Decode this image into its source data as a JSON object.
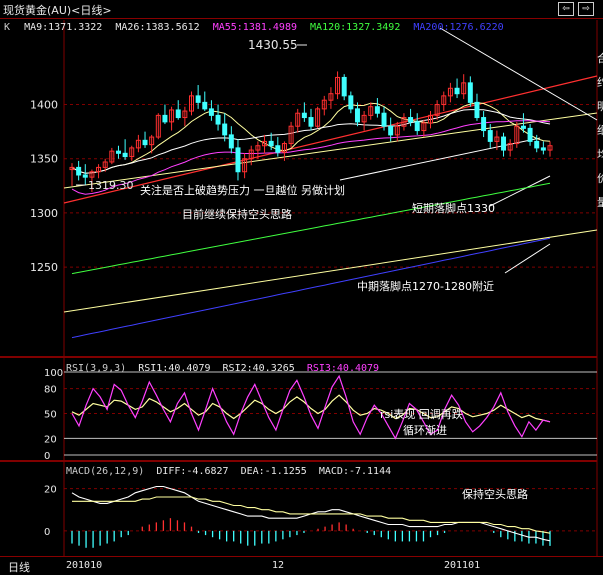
{
  "window": {
    "title": "现货黄金(AU)<日线>",
    "nav_left": "⇦",
    "nav_right": "⇨"
  },
  "main_legend": {
    "prefix": "K",
    "items": [
      {
        "label": "MA9:1371.3322",
        "color": "#e8e8e8"
      },
      {
        "label": "MA26:1383.5612",
        "color": "#e8e8e8"
      },
      {
        "label": "MA55:1381.4989",
        "color": "#ff40ff"
      },
      {
        "label": "MA120:1327.3492",
        "color": "#40ff40"
      },
      {
        "label": "MA200:1276.6220",
        "color": "#4040ff"
      }
    ]
  },
  "rsi_legend": {
    "items": [
      {
        "label": "RSI(3,9,3)",
        "color": "#ccc"
      },
      {
        "label": "RSI1:40.4079",
        "color": "#e8e8e8"
      },
      {
        "label": "RSI2:40.3265",
        "color": "#e8e8e8"
      },
      {
        "label": "RSI3:40.4079",
        "color": "#ff40ff"
      }
    ]
  },
  "macd_legend": {
    "items": [
      {
        "label": "MACD(26,12,9)",
        "color": "#ccc"
      },
      {
        "label": "DIFF:-4.6827",
        "color": "#e8e8e8"
      },
      {
        "label": "DEA:-1.1255",
        "color": "#e8e8e8"
      },
      {
        "label": "MACD:-7.1144",
        "color": "#e8e8e8"
      }
    ]
  },
  "annotations": {
    "high_label": "1430.55",
    "low_label": "1319.30",
    "note_resistance": "关注是否上破趋势压力 一旦越位 另做计划",
    "note_bias": "目前继续保持空头思路",
    "note_short": "短期落脚点1330",
    "note_mid": "中期落脚点1270-1280附近",
    "note_rsi_1": "rsi表现 回调再跌",
    "note_rsi_2": "循环渐进",
    "note_macd": "保持空头思路"
  },
  "bottom_bar": {
    "label": "日线",
    "dates": [
      "201010",
      "12",
      "201101"
    ]
  },
  "sidebar_chars": [
    "合",
    "约",
    "明",
    "细",
    "均",
    "价",
    "量"
  ],
  "colors": {
    "bull": "#ff3030",
    "bear": "#40ffff",
    "grid": "#800000",
    "ma9": "#ffffa0",
    "ma26": "#ffffff",
    "ma55": "#ff40ff",
    "ma120": "#40ff40",
    "ma200": "#4040ff"
  },
  "chart_data": [
    {
      "type": "candlestick",
      "title": "现货黄金(AU)<日线>",
      "y_ticks": [
        1250,
        1300,
        1350,
        1400
      ],
      "ylim": [
        1168,
        1478
      ],
      "x_labels": [
        "201010",
        "12",
        "201101"
      ],
      "candles": [
        [
          1340,
          1346,
          1325,
          1342
        ],
        [
          1342,
          1348,
          1330,
          1335
        ],
        [
          1335,
          1345,
          1326,
          1333
        ],
        [
          1333,
          1340,
          1319.3,
          1338
        ],
        [
          1338,
          1345,
          1332,
          1342
        ],
        [
          1342,
          1350,
          1338,
          1347
        ],
        [
          1347,
          1360,
          1345,
          1357
        ],
        [
          1357,
          1362,
          1350,
          1355
        ],
        [
          1355,
          1368,
          1349,
          1352
        ],
        [
          1352,
          1362,
          1348,
          1360
        ],
        [
          1360,
          1372,
          1356,
          1367
        ],
        [
          1367,
          1375,
          1360,
          1363
        ],
        [
          1363,
          1372,
          1355,
          1370
        ],
        [
          1370,
          1392,
          1368,
          1390
        ],
        [
          1390,
          1400,
          1382,
          1384
        ],
        [
          1384,
          1398,
          1376,
          1395
        ],
        [
          1395,
          1404,
          1386,
          1388
        ],
        [
          1388,
          1398,
          1380,
          1394
        ],
        [
          1394,
          1412,
          1390,
          1408
        ],
        [
          1408,
          1418,
          1396,
          1402
        ],
        [
          1402,
          1412,
          1394,
          1396
        ],
        [
          1396,
          1404,
          1385,
          1390
        ],
        [
          1390,
          1400,
          1376,
          1382
        ],
        [
          1382,
          1392,
          1366,
          1372
        ],
        [
          1372,
          1380,
          1355,
          1360
        ],
        [
          1360,
          1368,
          1330,
          1338
        ],
        [
          1338,
          1355,
          1332,
          1350
        ],
        [
          1350,
          1362,
          1344,
          1358
        ],
        [
          1358,
          1366,
          1350,
          1362
        ],
        [
          1362,
          1372,
          1355,
          1366
        ],
        [
          1366,
          1374,
          1358,
          1362
        ],
        [
          1362,
          1370,
          1352,
          1356
        ],
        [
          1356,
          1366,
          1348,
          1364
        ],
        [
          1364,
          1384,
          1360,
          1380
        ],
        [
          1380,
          1396,
          1374,
          1392
        ],
        [
          1392,
          1402,
          1384,
          1388
        ],
        [
          1388,
          1396,
          1376,
          1380
        ],
        [
          1380,
          1398,
          1378,
          1396
        ],
        [
          1396,
          1408,
          1390,
          1404
        ],
        [
          1404,
          1416,
          1396,
          1410
        ],
        [
          1410,
          1430.55,
          1405,
          1425
        ],
        [
          1425,
          1428,
          1404,
          1408
        ],
        [
          1408,
          1412,
          1392,
          1396
        ],
        [
          1396,
          1402,
          1380,
          1384
        ],
        [
          1384,
          1394,
          1376,
          1390
        ],
        [
          1390,
          1402,
          1386,
          1398
        ],
        [
          1398,
          1406,
          1388,
          1392
        ],
        [
          1392,
          1398,
          1376,
          1380
        ],
        [
          1380,
          1388,
          1366,
          1372
        ],
        [
          1372,
          1384,
          1366,
          1380
        ],
        [
          1380,
          1392,
          1376,
          1388
        ],
        [
          1388,
          1396,
          1380,
          1384
        ],
        [
          1384,
          1392,
          1372,
          1376
        ],
        [
          1376,
          1386,
          1370,
          1383
        ],
        [
          1383,
          1394,
          1378,
          1390
        ],
        [
          1390,
          1404,
          1386,
          1400
        ],
        [
          1400,
          1412,
          1394,
          1408
        ],
        [
          1408,
          1420,
          1402,
          1415
        ],
        [
          1415,
          1424,
          1406,
          1410
        ],
        [
          1410,
          1428,
          1405,
          1420
        ],
        [
          1420,
          1426,
          1398,
          1402
        ],
        [
          1402,
          1410,
          1385,
          1388
        ],
        [
          1388,
          1394,
          1370,
          1376
        ],
        [
          1376,
          1382,
          1360,
          1366
        ],
        [
          1366,
          1376,
          1358,
          1370
        ],
        [
          1370,
          1374,
          1352,
          1358
        ],
        [
          1358,
          1368,
          1352,
          1364
        ],
        [
          1364,
          1384,
          1360,
          1380
        ],
        [
          1380,
          1392,
          1374,
          1378
        ],
        [
          1378,
          1382,
          1362,
          1366
        ],
        [
          1366,
          1372,
          1356,
          1360
        ],
        [
          1360,
          1366,
          1354,
          1358
        ],
        [
          1358,
          1366,
          1352,
          1362
        ]
      ],
      "series": [
        {
          "name": "MA9",
          "value": 1371.3322
        },
        {
          "name": "MA26",
          "value": 1383.5612
        },
        {
          "name": "MA55",
          "value": 1381.4989
        },
        {
          "name": "MA120",
          "value": 1327.3492
        },
        {
          "name": "MA200",
          "value": 1276.622
        }
      ]
    },
    {
      "type": "line",
      "title": "RSI(3,9,3)",
      "y_ticks": [
        0,
        20,
        50,
        80,
        100
      ],
      "ylim": [
        0,
        100
      ],
      "series": [
        {
          "name": "RSI1",
          "last": 40.4079,
          "values": [
            50,
            35,
            60,
            80,
            70,
            55,
            85,
            78,
            60,
            45,
            65,
            88,
            72,
            55,
            40,
            62,
            75,
            50,
            30,
            55,
            80,
            60,
            40,
            25,
            50,
            70,
            85,
            65,
            45,
            30,
            55,
            78,
            90,
            70,
            48,
            32,
            58,
            82,
            95,
            70,
            40,
            25,
            45,
            60,
            50,
            35,
            20,
            40,
            62,
            55,
            40,
            25,
            30,
            55,
            72,
            60,
            40,
            28,
            35,
            45,
            58,
            75,
            52,
            35,
            22,
            40,
            30,
            42,
            40
          ]
        },
        {
          "name": "RSI2",
          "last": 40.3265,
          "values": [
            52,
            48,
            55,
            62,
            60,
            58,
            66,
            65,
            60,
            55,
            58,
            68,
            64,
            58,
            52,
            56,
            62,
            55,
            48,
            52,
            62,
            58,
            50,
            44,
            50,
            58,
            66,
            62,
            55,
            50,
            55,
            64,
            70,
            64,
            56,
            50,
            55,
            65,
            72,
            64,
            54,
            48,
            50,
            56,
            54,
            50,
            44,
            48,
            56,
            55,
            50,
            45,
            46,
            52,
            58,
            56,
            50,
            46,
            48,
            50,
            54,
            60,
            55,
            50,
            45,
            48,
            44,
            42,
            40
          ]
        },
        {
          "name": "RSI3",
          "last": 40.4079,
          "values": [
            50,
            35,
            60,
            80,
            70,
            55,
            85,
            78,
            60,
            45,
            65,
            88,
            72,
            55,
            40,
            62,
            75,
            50,
            30,
            55,
            80,
            60,
            40,
            25,
            50,
            70,
            85,
            65,
            45,
            30,
            55,
            78,
            90,
            70,
            48,
            32,
            58,
            82,
            95,
            70,
            40,
            25,
            45,
            60,
            50,
            35,
            20,
            40,
            62,
            55,
            40,
            25,
            30,
            55,
            72,
            60,
            40,
            28,
            35,
            45,
            58,
            75,
            52,
            35,
            22,
            40,
            30,
            42,
            40
          ]
        }
      ]
    },
    {
      "type": "bar",
      "title": "MACD(26,12,9)",
      "y_ticks": [
        0,
        20
      ],
      "ylim": [
        -10,
        25
      ],
      "series": [
        {
          "name": "DIFF",
          "last": -4.6827,
          "values": [
            18,
            16,
            15,
            14,
            13,
            13,
            14,
            15,
            16,
            18,
            19,
            20,
            21,
            21,
            20,
            19,
            18,
            16,
            14,
            13,
            12,
            11,
            10,
            9,
            8,
            7,
            7,
            7,
            6,
            6,
            6,
            6,
            6,
            7,
            8,
            9,
            9,
            10,
            10,
            9,
            8,
            7,
            6,
            5,
            4,
            3,
            3,
            3,
            2,
            2,
            2,
            2,
            2,
            3,
            3,
            4,
            4,
            4,
            4,
            3,
            2,
            1,
            0,
            -1,
            -2,
            -3,
            -3,
            -4,
            -4.6827
          ]
        },
        {
          "name": "DEA",
          "last": -1.1255,
          "values": [
            14,
            14,
            14,
            14,
            14,
            14,
            14,
            14,
            14,
            14,
            15,
            15,
            16,
            16,
            16,
            16,
            16,
            16,
            15,
            15,
            14,
            14,
            13,
            12,
            12,
            11,
            11,
            10,
            10,
            9,
            9,
            8,
            8,
            8,
            8,
            8,
            8,
            8,
            8,
            8,
            8,
            8,
            7,
            7,
            7,
            6,
            6,
            6,
            5,
            5,
            5,
            4,
            4,
            4,
            4,
            4,
            4,
            4,
            4,
            4,
            3,
            3,
            2,
            2,
            1,
            1,
            0,
            -0.5,
            -1.1255
          ]
        },
        {
          "name": "MACD",
          "last": -7.1144,
          "values": [
            -6,
            -7,
            -8,
            -8,
            -7,
            -6,
            -5,
            -3,
            -2,
            0,
            2,
            3,
            4,
            5,
            6,
            5,
            4,
            2,
            -1,
            -2,
            -3,
            -4,
            -5,
            -5,
            -6,
            -7,
            -7,
            -6,
            -6,
            -5,
            -4,
            -3,
            -2,
            -1,
            0,
            1,
            2,
            3,
            4,
            3,
            1,
            0,
            -1,
            -2,
            -3,
            -4,
            -5,
            -5,
            -5,
            -5,
            -5,
            -3,
            -2,
            -1,
            0,
            0,
            0,
            0,
            0,
            0,
            -1,
            -3,
            -4,
            -5,
            -5,
            -6,
            -6,
            -7,
            -7.1144
          ]
        }
      ]
    }
  ]
}
